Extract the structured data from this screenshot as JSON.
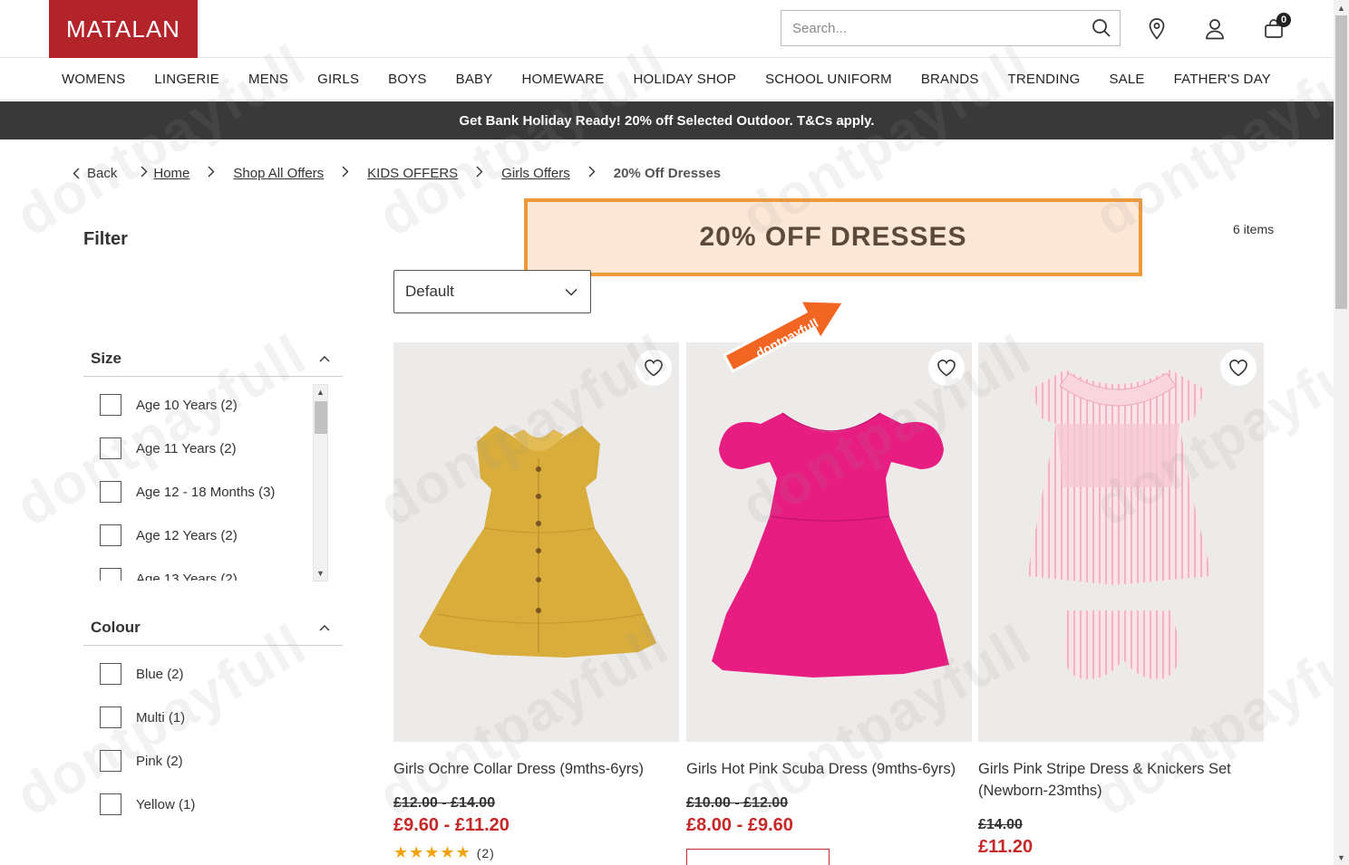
{
  "brand": {
    "logo_text": "MATALAN",
    "color": "#b3242a"
  },
  "search": {
    "placeholder": "Search..."
  },
  "header_icons": {
    "store": "store-locator-icon",
    "account": "account-icon",
    "cart": "basket-icon",
    "cart_count": "0"
  },
  "nav": [
    "WOMENS",
    "LINGERIE",
    "MENS",
    "GIRLS",
    "BOYS",
    "BABY",
    "HOMEWARE",
    "HOLIDAY SHOP",
    "SCHOOL UNIFORM",
    "BRANDS",
    "TRENDING",
    "SALE",
    "FATHER'S DAY"
  ],
  "promo_text": "Get Bank Holiday Ready! 20% off Selected Outdoor. T&Cs apply.",
  "breadcrumb": {
    "back": "Back",
    "items": [
      "Home",
      "Shop All Offers",
      "KIDS OFFERS",
      "Girls Offers"
    ],
    "current": "20% Off Dresses"
  },
  "filter": {
    "title": "Filter",
    "size": {
      "label": "Size",
      "options": [
        "Age 10 Years (2)",
        "Age 11 Years (2)",
        "Age 12 - 18 Months (3)",
        "Age 12 Years (2)",
        "Age 13 Years (2)"
      ]
    },
    "colour": {
      "label": "Colour",
      "options": [
        "Blue (2)",
        "Multi (1)",
        "Pink (2)",
        "Yellow (1)"
      ]
    }
  },
  "listing": {
    "heading": "20% OFF DRESSES",
    "item_count": "6 items",
    "sort_value": "Default"
  },
  "watermark": "dontpayfull",
  "products": [
    {
      "name": "Girls Ochre Collar Dress (9mths-6yrs)",
      "was": "£12.00 - £14.00",
      "now": "£9.60 - £11.20",
      "reviews": "(2)",
      "rating": 5
    },
    {
      "name": "Girls Hot Pink Scuba Dress (9mths-6yrs)",
      "was": "£10.00 - £12.00",
      "now": "£8.00 - £9.60"
    },
    {
      "name": "Girls Pink Stripe Dress & Knickers Set (Newborn-23mths)",
      "was": "£14.00",
      "now": "£11.20"
    }
  ],
  "colors": {
    "sale_price": "#c62828",
    "promo_bg": "#393939",
    "heading_bg": "#fde8d6",
    "heading_border": "#ef9a3a"
  }
}
